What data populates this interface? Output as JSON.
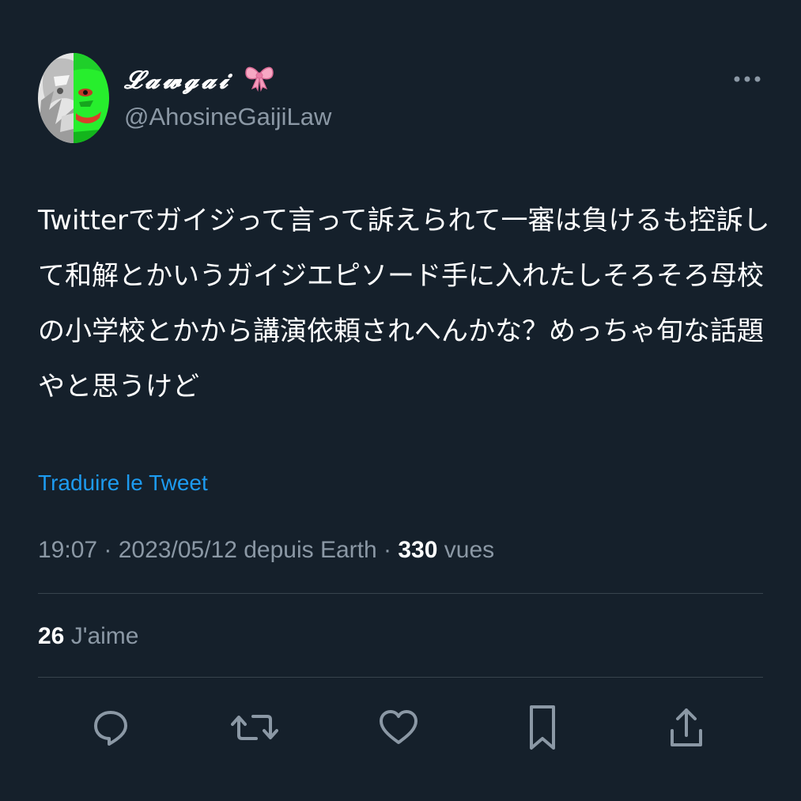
{
  "author": {
    "display_name": "𝓛𝓪𝔀𝓰𝓪𝓲",
    "handle": "@AhosineGaijiLaw",
    "avatar_icon": "profile-avatar",
    "badge_icon": "ribbon-bow-icon"
  },
  "tweet": {
    "lines": [
      "Twitterでガイジって言って訴えられて一審は負けるも控訴し",
      "て和解とかいうガイジエピソード手に入れたしそろそろ母校",
      "の小学校とかから講演依頼されへんかな？めっちゃ旬な話題",
      "やと思うけど"
    ],
    "translate_label": "Traduire le Tweet"
  },
  "meta": {
    "time": "19:07",
    "separator": " · ",
    "date": "2023/05/12",
    "source": "depuis Earth",
    "views": "330",
    "views_label": "vues"
  },
  "stats": {
    "likes": "26",
    "likes_label": "J'aime"
  },
  "actions": [
    {
      "icon": "reply-icon"
    },
    {
      "icon": "retweet-icon"
    },
    {
      "icon": "like-heart-icon"
    },
    {
      "icon": "bookmark-icon"
    },
    {
      "icon": "share-icon"
    }
  ],
  "colors": {
    "background": "#15202b",
    "text_primary": "#ffffff",
    "text_secondary": "#8b98a5",
    "link": "#1d9bf0",
    "divider": "#38444d",
    "icon": "#8b98a5"
  }
}
